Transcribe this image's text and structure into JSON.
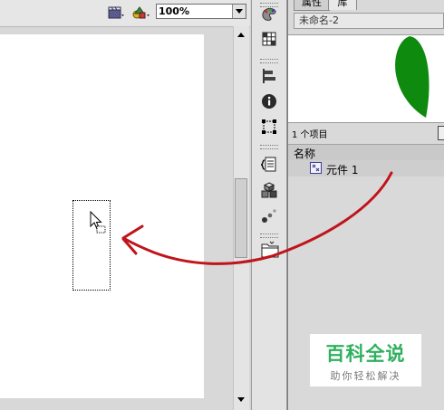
{
  "toolbar": {
    "zoom_value": "100%",
    "scene_icon": "edit-scene-icon",
    "symbol_icon": "edit-symbol-icon"
  },
  "tool_strip": {
    "icons": [
      "color-palette-icon",
      "grid-swatches-icon",
      "align-icon",
      "info-icon",
      "transform-icon",
      "actions-script-icon",
      "components-icon",
      "motion-presets-icon",
      "library-folder-icon"
    ]
  },
  "library_panel": {
    "tab_properties": "属性",
    "tab_library": "库",
    "document_name": "未命名-2",
    "item_count": "1 个项目",
    "column_name": "名称",
    "items": [
      {
        "label": "元件 1",
        "icon": "symbol-icon"
      }
    ],
    "preview_fill": "#0e8a0e"
  },
  "watermark": {
    "title": "百科全说",
    "subtitle": "助你轻松解决",
    "color": "#2fb05e"
  },
  "annotation": {
    "arrow_color": "#c0141b"
  }
}
